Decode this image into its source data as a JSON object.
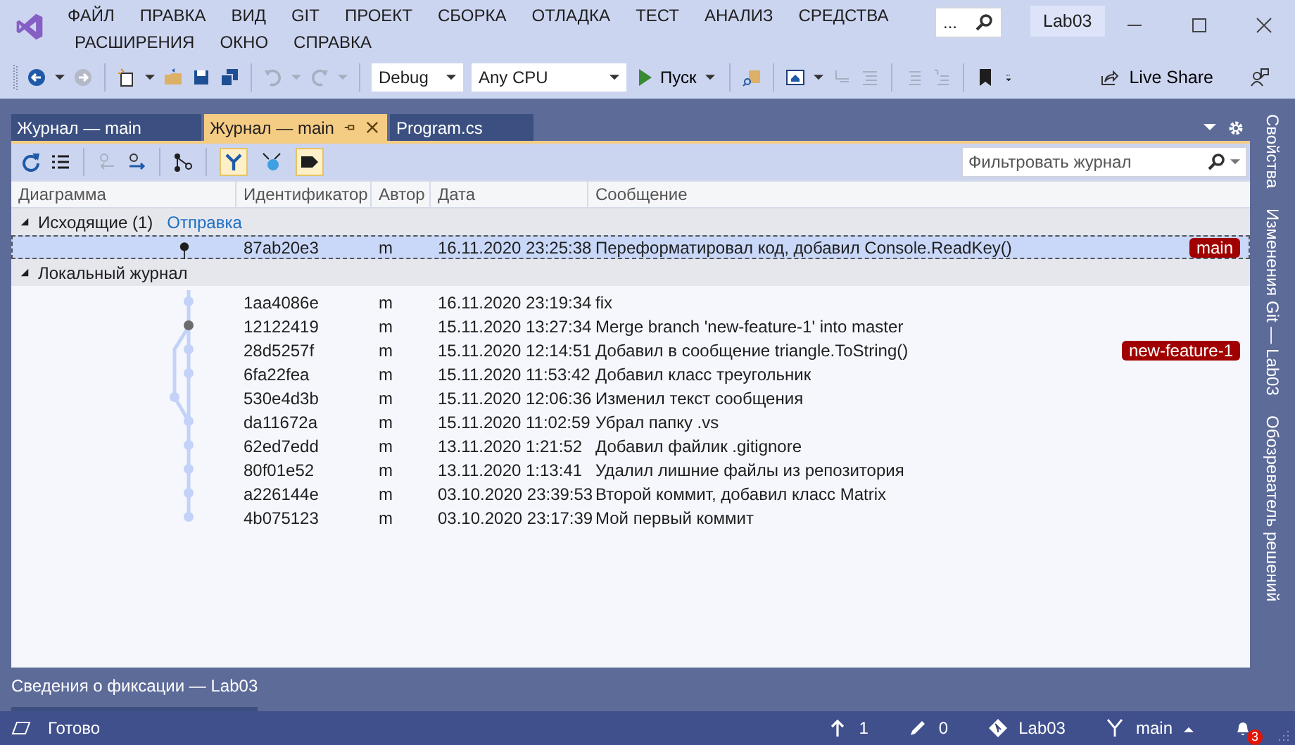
{
  "menu": [
    {
      "label": "ФАЙЛ"
    },
    {
      "label": "ПРАВКА"
    },
    {
      "label": "ВИД"
    },
    {
      "label": "GIT"
    },
    {
      "label": "ПРОЕКТ"
    },
    {
      "label": "СБОРКА"
    },
    {
      "label": "ОТЛАДКА"
    },
    {
      "label": "ТЕСТ"
    },
    {
      "label": "АНАЛИЗ"
    },
    {
      "label": "СРЕДСТВА"
    },
    {
      "label": "РАСШИРЕНИЯ"
    },
    {
      "label": "ОКНО"
    },
    {
      "label": "СПРАВКА"
    }
  ],
  "search": {
    "value": "..."
  },
  "solution": "Lab03",
  "toolbar": {
    "configuration": "Debug",
    "platform": "Any CPU",
    "run": "Пуск",
    "live_share": "Live Share"
  },
  "tabs": [
    {
      "label": "Журнал — main",
      "selected": false
    },
    {
      "label": "Журнал — main",
      "selected": true
    },
    {
      "label": "Program.cs",
      "selected": false
    }
  ],
  "log_toolbar": {
    "toggles": [
      {
        "kind": "branches",
        "on": true
      },
      {
        "kind": "remote",
        "on": false
      },
      {
        "kind": "tags",
        "on": true
      }
    ],
    "filter": {
      "placeholder": "Фильтровать журнал"
    }
  },
  "columns": [
    "Диаграмма",
    "Идентификатор",
    "Автор",
    "Дата",
    "Сообщение"
  ],
  "groups": [
    {
      "title": "Исходящие (1)",
      "action": "Отправка",
      "expanded": true,
      "rows": [
        {
          "id": "87ab20e3",
          "author": "m",
          "date": "16.11.2020 23:25:38",
          "message": "Переформатировал код, добавил Console.ReadKey()",
          "tag": "main",
          "selected": true
        }
      ]
    },
    {
      "title": "Локальный журнал",
      "expanded": true,
      "rows": [
        {
          "id": "1aa4086e",
          "author": "m",
          "date": "16.11.2020 23:19:34",
          "message": "fix",
          "selected": false
        },
        {
          "id": "12122419",
          "author": "m",
          "date": "15.11.2020 13:27:34",
          "message": "Merge branch 'new-feature-1' into master",
          "selected": false
        },
        {
          "id": "28d5257f",
          "author": "m",
          "date": "15.11.2020 12:14:51",
          "message": "Добавил в сообщение triangle.ToString()",
          "tag": "new-feature-1",
          "selected": false
        },
        {
          "id": "6fa22fea",
          "author": "m",
          "date": "15.11.2020 11:53:42",
          "message": "Добавил класс треугольник",
          "selected": false
        },
        {
          "id": "530e4d3b",
          "author": "m",
          "date": "15.11.2020 12:06:36",
          "message": "Изменил текст сообщения",
          "selected": false
        },
        {
          "id": "da11672a",
          "author": "m",
          "date": "15.11.2020 11:02:59",
          "message": "Убрал папку .vs",
          "selected": false
        },
        {
          "id": "62ed7edd",
          "author": "m",
          "date": "13.11.2020 1:21:52",
          "message": "Добавил файлик .gitignore",
          "selected": false
        },
        {
          "id": "80f01e52",
          "author": "m",
          "date": "13.11.2020 1:13:41",
          "message": "Удалил лишние файлы из репозитория",
          "selected": false
        },
        {
          "id": "a226144e",
          "author": "m",
          "date": "03.10.2020 23:39:53",
          "message": "Второй коммит, добавил класс Matrix",
          "selected": false
        },
        {
          "id": "4b075123",
          "author": "m",
          "date": "03.10.2020 23:17:39",
          "message": "Мой первый коммит",
          "selected": false
        }
      ]
    }
  ],
  "side_tabs": [
    "Свойства",
    "Изменения Git — Lab03",
    "Обозреватель решений"
  ],
  "bottom_tab": "Сведения о фиксации — Lab03",
  "status": {
    "text": "Готово",
    "outgoing": "1",
    "changes": "0",
    "repo": "Lab03",
    "branch": "main",
    "notifications": "3"
  }
}
